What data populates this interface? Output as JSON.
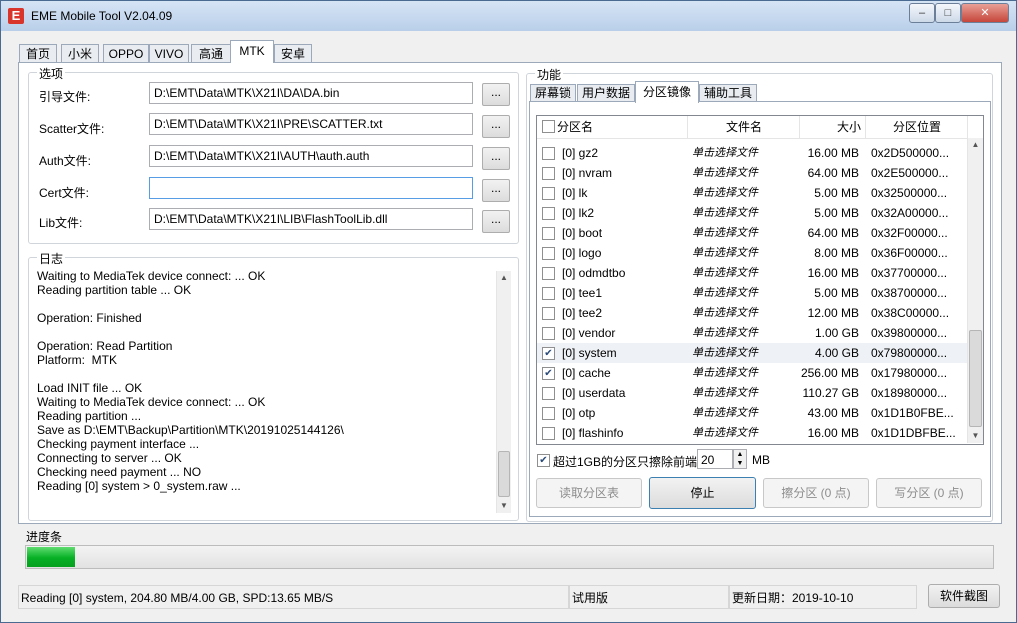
{
  "window": {
    "title": "EME Mobile Tool V2.04.09",
    "app_icon": "E"
  },
  "tabs": [
    "首页",
    "小米",
    "OPPO",
    "VIVO",
    "高通",
    "MTK",
    "安卓"
  ],
  "options": {
    "title": "选项",
    "fields": [
      {
        "label": "引导文件:",
        "value": "D:\\EMT\\Data\\MTK\\X21I\\DA\\DA.bin"
      },
      {
        "label": "Scatter文件:",
        "value": "D:\\EMT\\Data\\MTK\\X21I\\PRE\\SCATTER.txt"
      },
      {
        "label": "Auth文件:",
        "value": "D:\\EMT\\Data\\MTK\\X21I\\AUTH\\auth.auth"
      },
      {
        "label": "Cert文件:",
        "value": ""
      },
      {
        "label": "Lib文件:",
        "value": "D:\\EMT\\Data\\MTK\\X21I\\LIB\\FlashToolLib.dll"
      }
    ],
    "browse_label": "..."
  },
  "log": {
    "title": "日志",
    "lines": [
      "Waiting to MediaTek device connect: ... OK",
      "Reading partition table ... OK",
      "",
      "Operation: Finished",
      "",
      "Operation: Read Partition",
      "Platform:  MTK",
      "",
      "Load INIT file ... OK",
      "Waiting to MediaTek device connect: ... OK",
      "Reading partition ...",
      "Save as D:\\EMT\\Backup\\Partition\\MTK\\20191025144126\\",
      "Checking payment interface ...",
      "Connecting to server ... OK",
      "Checking need payment ... NO",
      "Reading [0] system > 0_system.raw ..."
    ]
  },
  "function": {
    "title": "功能",
    "subtabs": [
      "屏幕锁",
      "用户数据",
      "分区镜像",
      "辅助工具"
    ],
    "columns": [
      "分区名",
      "文件名",
      "大小",
      "分区位置"
    ],
    "partitions": [
      {
        "name": "[0] gz2",
        "file": "单击选择文件",
        "size": "16.00 MB",
        "pos": "0x2D500000...",
        "checked": false
      },
      {
        "name": "[0] nvram",
        "file": "单击选择文件",
        "size": "64.00 MB",
        "pos": "0x2E500000...",
        "checked": false
      },
      {
        "name": "[0] lk",
        "file": "单击选择文件",
        "size": "5.00 MB",
        "pos": "0x32500000...",
        "checked": false
      },
      {
        "name": "[0] lk2",
        "file": "单击选择文件",
        "size": "5.00 MB",
        "pos": "0x32A00000...",
        "checked": false
      },
      {
        "name": "[0] boot",
        "file": "单击选择文件",
        "size": "64.00 MB",
        "pos": "0x32F00000...",
        "checked": false
      },
      {
        "name": "[0] logo",
        "file": "单击选择文件",
        "size": "8.00 MB",
        "pos": "0x36F00000...",
        "checked": false
      },
      {
        "name": "[0] odmdtbo",
        "file": "单击选择文件",
        "size": "16.00 MB",
        "pos": "0x37700000...",
        "checked": false
      },
      {
        "name": "[0] tee1",
        "file": "单击选择文件",
        "size": "5.00 MB",
        "pos": "0x38700000...",
        "checked": false
      },
      {
        "name": "[0] tee2",
        "file": "单击选择文件",
        "size": "12.00 MB",
        "pos": "0x38C00000...",
        "checked": false
      },
      {
        "name": "[0] vendor",
        "file": "单击选择文件",
        "size": "1.00 GB",
        "pos": "0x39800000...",
        "checked": false
      },
      {
        "name": "[0] system",
        "file": "单击选择文件",
        "size": "4.00 GB",
        "pos": "0x79800000...",
        "checked": true
      },
      {
        "name": "[0] cache",
        "file": "单击选择文件",
        "size": "256.00 MB",
        "pos": "0x17980000...",
        "checked": true
      },
      {
        "name": "[0] userdata",
        "file": "单击选择文件",
        "size": "110.27 GB",
        "pos": "0x18980000...",
        "checked": false
      },
      {
        "name": "[0] otp",
        "file": "单击选择文件",
        "size": "43.00 MB",
        "pos": "0x1D1B0FBE...",
        "checked": false
      },
      {
        "name": "[0] flashinfo",
        "file": "单击选择文件",
        "size": "16.00 MB",
        "pos": "0x1D1DBFBE...",
        "checked": false
      }
    ],
    "erase_option": {
      "label": "超过1GB的分区只擦除前端",
      "value": "20",
      "unit": "MB",
      "checked": true
    },
    "buttons": [
      {
        "label": "读取分区表",
        "enabled": false
      },
      {
        "label": "停止",
        "enabled": true
      },
      {
        "label": "擦分区 (0 点)",
        "enabled": false
      },
      {
        "label": "写分区 (0 点)",
        "enabled": false
      }
    ]
  },
  "progress": {
    "title": "进度条",
    "value": 0.05,
    "color": "#06b025"
  },
  "status": {
    "message": "Reading [0] system, 204.80 MB/4.00 GB, SPD:13.65 MB/S",
    "edition": "试用版",
    "update_date": "更新日期：2019-10-10",
    "screenshot_button": "软件截图"
  }
}
